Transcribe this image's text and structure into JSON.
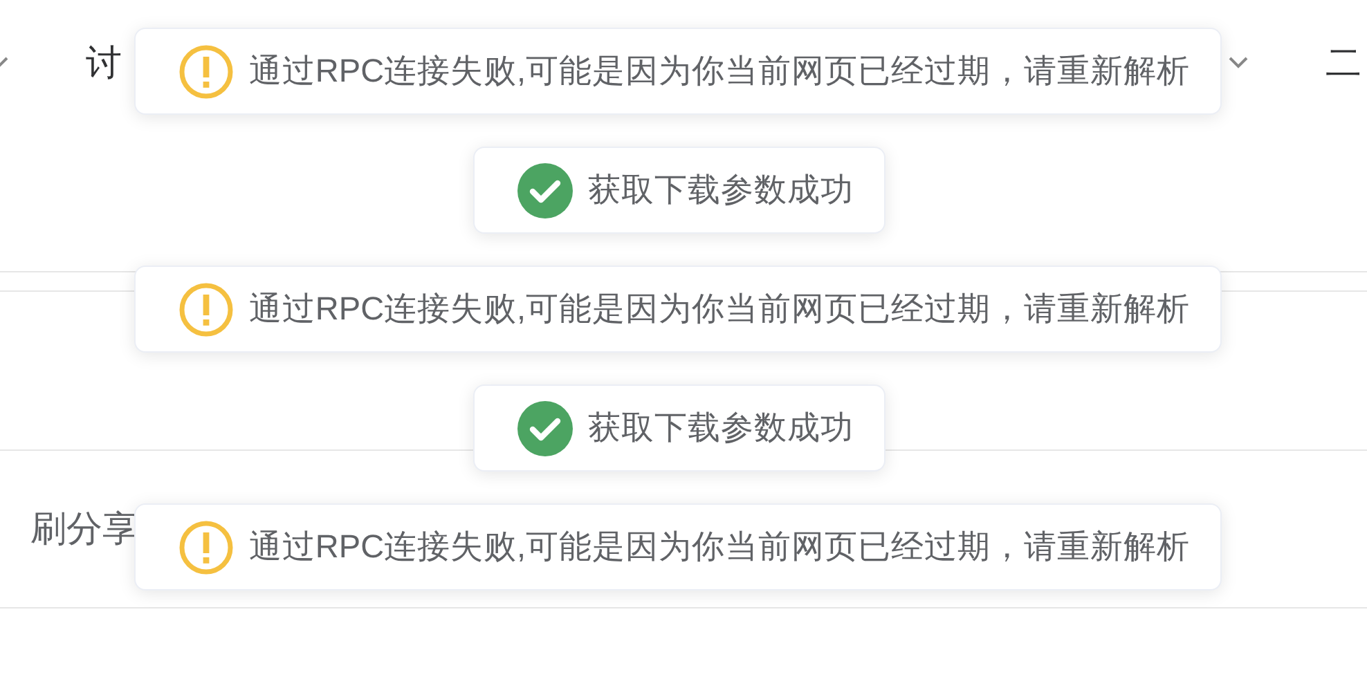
{
  "nav": [
    {
      "kind": "chevron"
    },
    {
      "kind": "text",
      "label": "讨"
    },
    {
      "kind": "chevron"
    },
    {
      "kind": "text",
      "label": "二"
    }
  ],
  "rows": [
    {
      "label": "刷分享"
    }
  ],
  "toasts": [
    {
      "kind": "warning",
      "message": "通过RPC连接失败,可能是因为你当前网页已经过期，请重新解析"
    },
    {
      "kind": "success",
      "message": "获取下载参数成功"
    },
    {
      "kind": "warning",
      "message": "通过RPC连接失败,可能是因为你当前网页已经过期，请重新解析"
    },
    {
      "kind": "success",
      "message": "获取下载参数成功"
    },
    {
      "kind": "warning",
      "message": "通过RPC连接失败,可能是因为你当前网页已经过期，请重新解析"
    }
  ]
}
